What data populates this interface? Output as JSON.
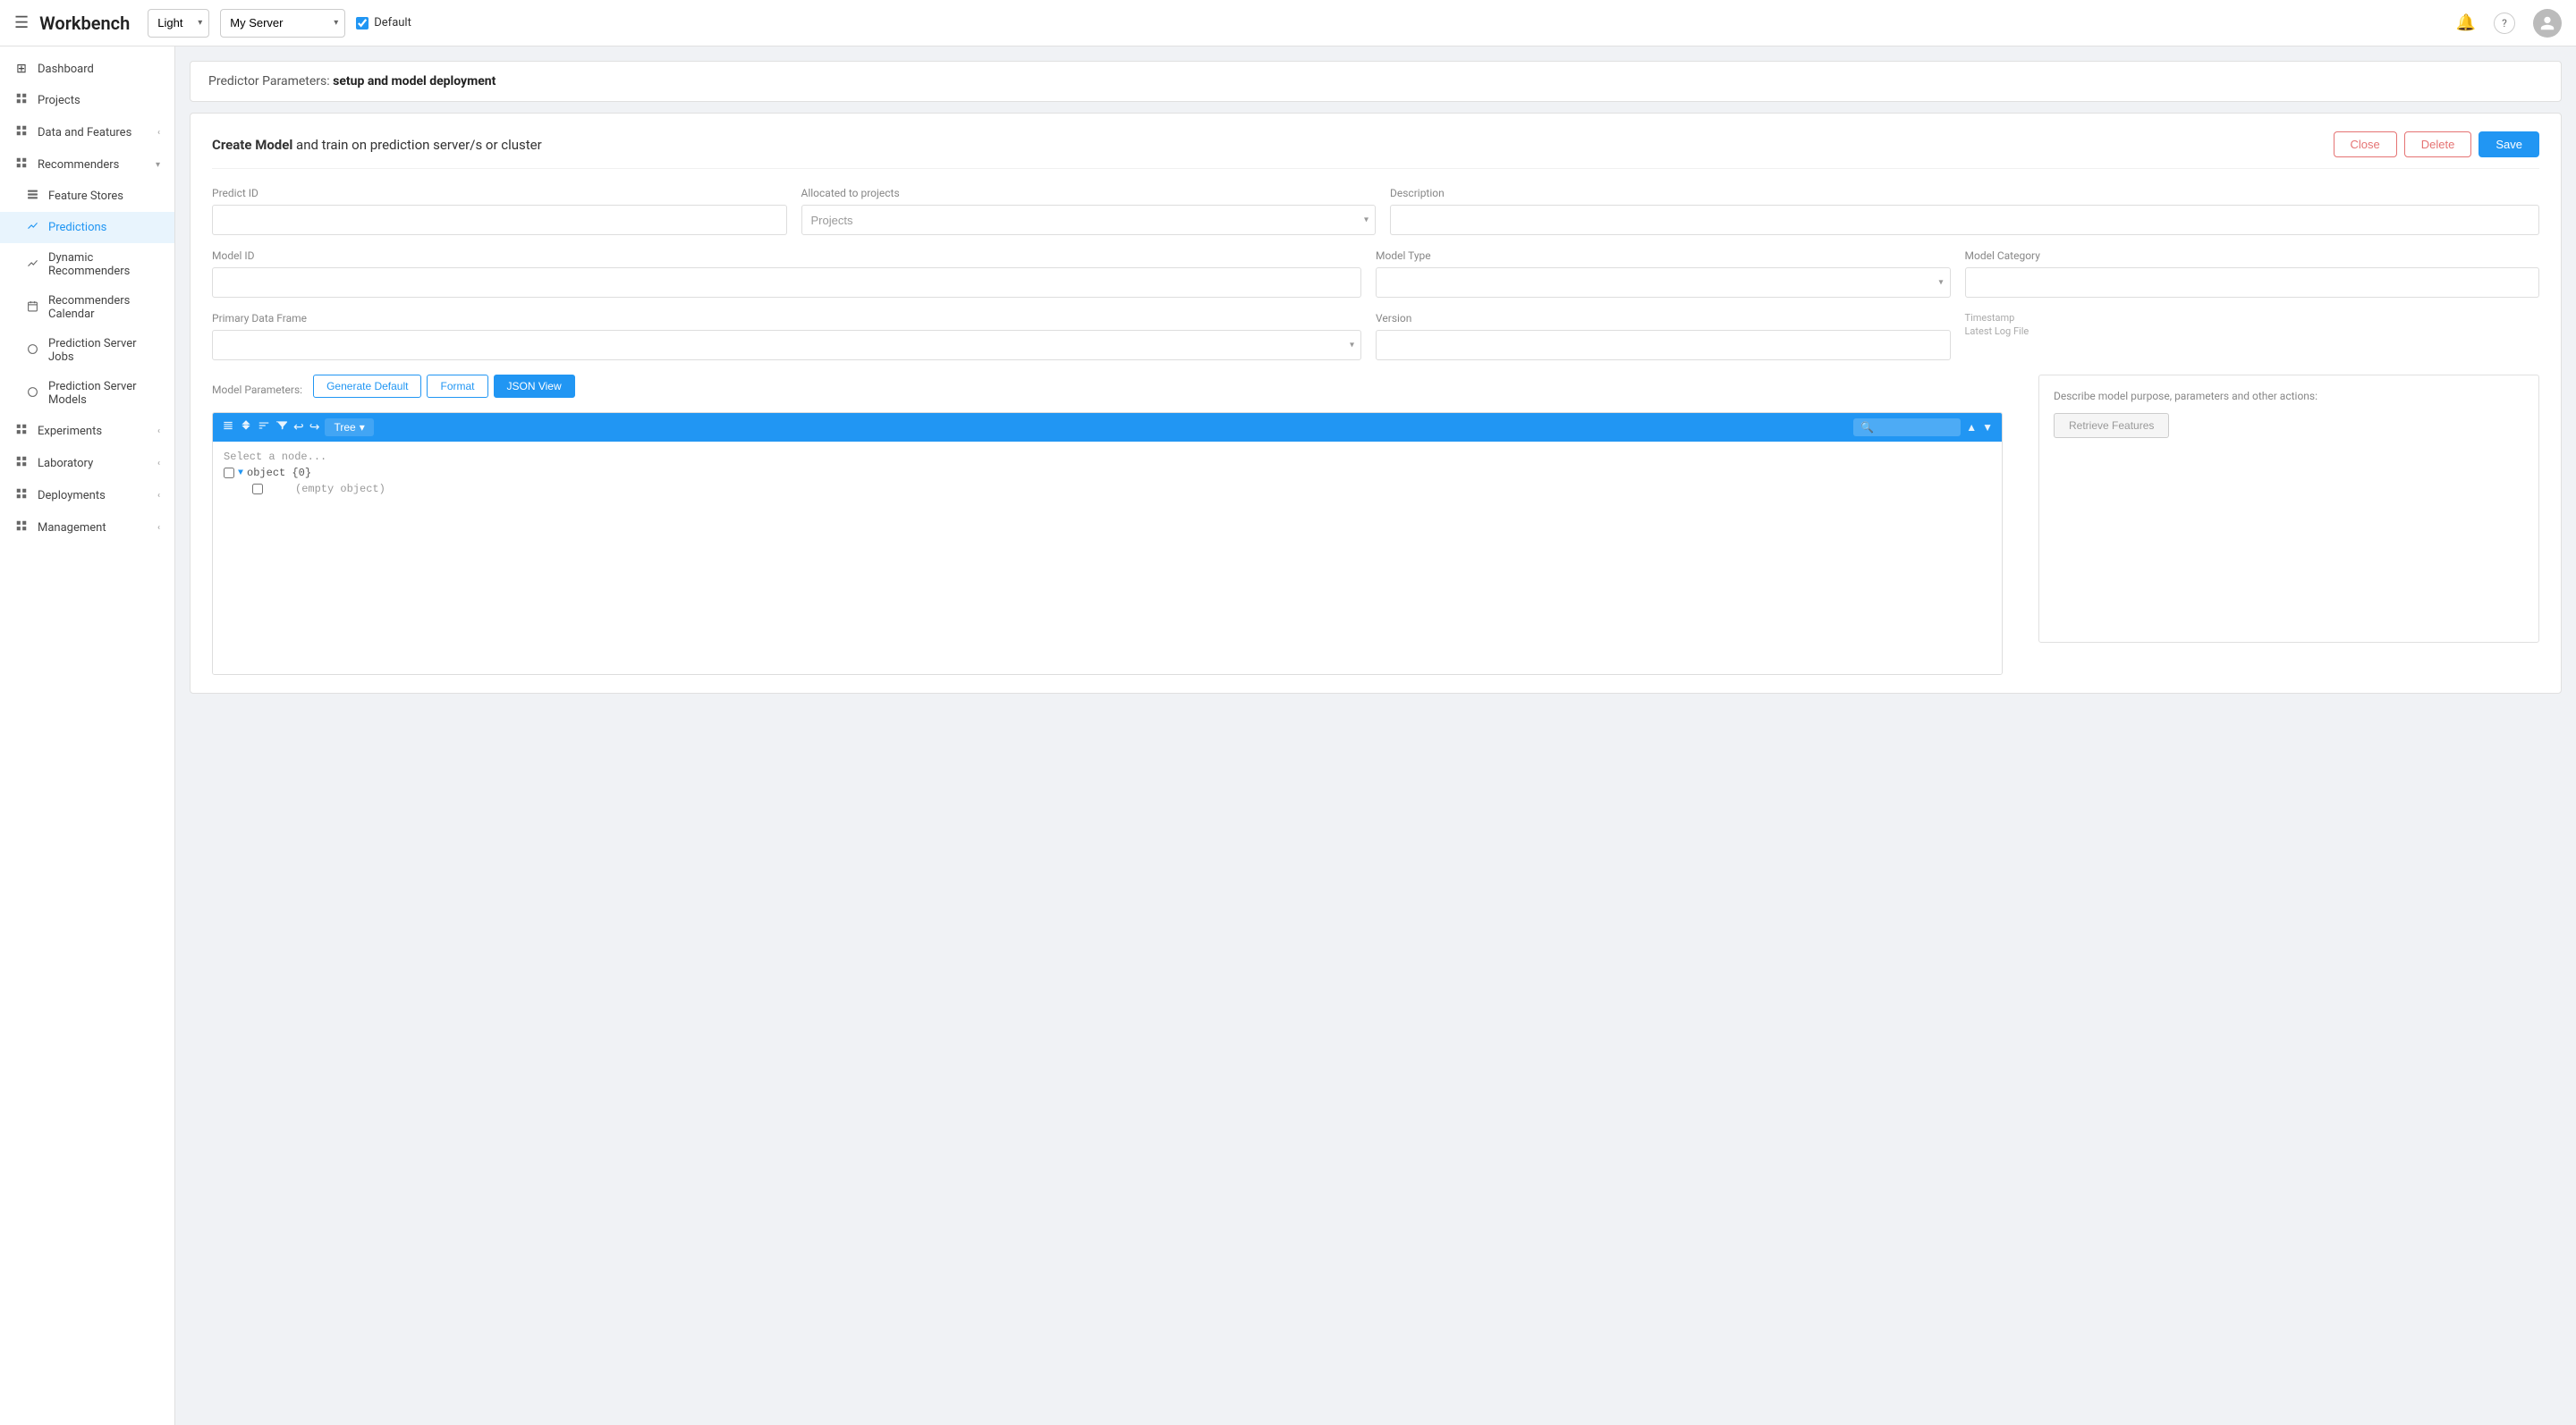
{
  "app": {
    "title": "Workbench",
    "menu_icon": "☰"
  },
  "topbar": {
    "theme_label": "Light",
    "server_label": "My Server",
    "default_label": "Default",
    "default_checked": true
  },
  "sidebar": {
    "items": [
      {
        "id": "dashboard",
        "label": "Dashboard",
        "icon": "⊞",
        "active": false,
        "has_arrow": false
      },
      {
        "id": "projects",
        "label": "Projects",
        "icon": "☰",
        "active": false,
        "has_arrow": false
      },
      {
        "id": "data-features",
        "label": "Data and Features",
        "icon": "⊞",
        "active": false,
        "has_arrow": true,
        "arrow_dir": "left"
      },
      {
        "id": "recommenders",
        "label": "Recommenders",
        "icon": "⊞",
        "active": false,
        "has_arrow": true,
        "arrow_dir": "down"
      },
      {
        "id": "feature-stores",
        "label": "Feature Stores",
        "icon": "⊟",
        "active": false,
        "has_arrow": false
      },
      {
        "id": "predictions",
        "label": "Predictions",
        "icon": "↗",
        "active": true,
        "has_arrow": false
      },
      {
        "id": "dynamic-recommenders",
        "label": "Dynamic Recommenders",
        "icon": "↗",
        "active": false,
        "has_arrow": false
      },
      {
        "id": "recommenders-calendar",
        "label": "Recommenders Calendar",
        "icon": "⊟",
        "active": false,
        "has_arrow": false
      },
      {
        "id": "prediction-server-jobs",
        "label": "Prediction Server Jobs",
        "icon": "○",
        "active": false,
        "has_arrow": false
      },
      {
        "id": "prediction-server-models",
        "label": "Prediction Server Models",
        "icon": "○",
        "active": false,
        "has_arrow": false
      },
      {
        "id": "experiments",
        "label": "Experiments",
        "icon": "⊞",
        "active": false,
        "has_arrow": true,
        "arrow_dir": "left"
      },
      {
        "id": "laboratory",
        "label": "Laboratory",
        "icon": "⊞",
        "active": false,
        "has_arrow": true,
        "arrow_dir": "left"
      },
      {
        "id": "deployments",
        "label": "Deployments",
        "icon": "⊞",
        "active": false,
        "has_arrow": true,
        "arrow_dir": "left"
      },
      {
        "id": "management",
        "label": "Management",
        "icon": "⊞",
        "active": false,
        "has_arrow": true,
        "arrow_dir": "left"
      }
    ]
  },
  "breadcrumb": {
    "prefix": "Predictor Parameters:",
    "bold": "setup and model deployment"
  },
  "form_card": {
    "title_prefix": "Create Model",
    "title_suffix": " and train on prediction server/s or cluster",
    "btn_close": "Close",
    "btn_delete": "Delete",
    "btn_save": "Save"
  },
  "fields": {
    "predict_id_label": "Predict ID",
    "predict_id_value": "",
    "allocated_label": "Allocated to projects",
    "allocated_placeholder": "Projects",
    "description_label": "Description",
    "description_value": "",
    "model_id_label": "Model ID",
    "model_id_value": "",
    "model_type_label": "Model Type",
    "model_type_value": "",
    "model_category_label": "Model Category",
    "model_category_value": "",
    "primary_df_label": "Primary Data Frame",
    "primary_df_value": "",
    "version_label": "Version",
    "version_value": "",
    "timestamp_label": "Timestamp",
    "log_label": "Latest Log File"
  },
  "model_params": {
    "label": "Model Parameters:",
    "btn_generate": "Generate Default",
    "btn_format": "Format",
    "btn_json": "JSON View",
    "tree_view_label": "Tree",
    "search_placeholder": "🔍",
    "select_node": "Select a node...",
    "object_label": "object {0}",
    "empty_label": "(empty object)"
  },
  "right_panel": {
    "description_label": "Describe model purpose, parameters and other actions:",
    "btn_retrieve": "Retrieve Features"
  },
  "icons": {
    "chevron_down": "▾",
    "chevron_left": "‹",
    "chevron_right": "›",
    "bell": "🔔",
    "help": "?",
    "tree_collapse": "⊖",
    "tree_expand": "⊕",
    "tree_sort": "⇅",
    "tree_filter": "⊟",
    "tree_undo": "↩",
    "tree_redo": "↪"
  }
}
